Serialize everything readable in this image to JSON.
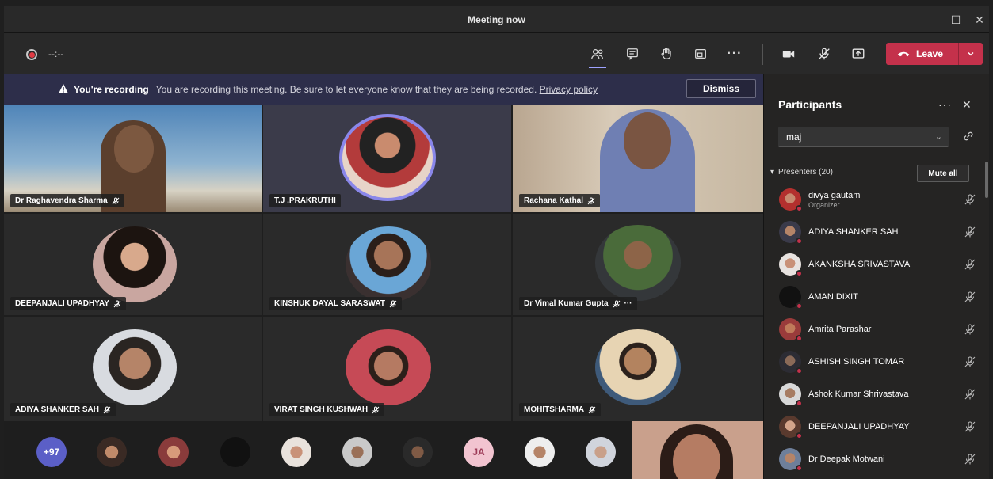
{
  "window": {
    "title": "Meeting now",
    "minimize": "–",
    "maximize": "☐",
    "close": "✕"
  },
  "toolbar": {
    "timer": "--:--",
    "leave_label": "Leave"
  },
  "banner": {
    "bold": "You're recording",
    "text": "You are recording this meeting. Be sure to let everyone know that they are being recorded.",
    "link": "Privacy policy",
    "dismiss": "Dismiss"
  },
  "tiles": [
    {
      "name": "Dr Raghavendra Sharma"
    },
    {
      "name": "T.J .PRAKRUTHI"
    },
    {
      "name": "Rachana Kathal"
    },
    {
      "name": "DEEPANJALI UPADHYAY"
    },
    {
      "name": "KINSHUK DAYAL SARASWAT"
    },
    {
      "name": "Dr Vimal Kumar Gupta"
    },
    {
      "name": "ADIYA SHANKER SAH"
    },
    {
      "name": "VIRAT SINGH KUSHWAH"
    },
    {
      "name": "MOHITSHARMA"
    }
  ],
  "tile_more": "···",
  "strip": {
    "overflow": "+97",
    "initials": "JA"
  },
  "panel": {
    "title": "Participants",
    "more": "···",
    "close": "✕",
    "search_value": "maj",
    "presenters_label": "Presenters (20)",
    "mute_all": "Mute all",
    "people": [
      {
        "name": "divya gautam",
        "role": "Organizer"
      },
      {
        "name": "ADIYA SHANKER SAH"
      },
      {
        "name": "AKANKSHA SRIVASTAVA"
      },
      {
        "name": "AMAN DIXIT"
      },
      {
        "name": "Amrita Parashar"
      },
      {
        "name": "ASHISH SINGH TOMAR"
      },
      {
        "name": "Ashok Kumar Shrivastava"
      },
      {
        "name": "DEEPANJALI UPADHYAY"
      },
      {
        "name": "Dr Deepak Motwani"
      }
    ]
  },
  "colors": {
    "accent": "#9ea2ff",
    "leave": "#c4314b",
    "banner": "#2d2e4a",
    "initials_bg": "#f2c4d0"
  }
}
